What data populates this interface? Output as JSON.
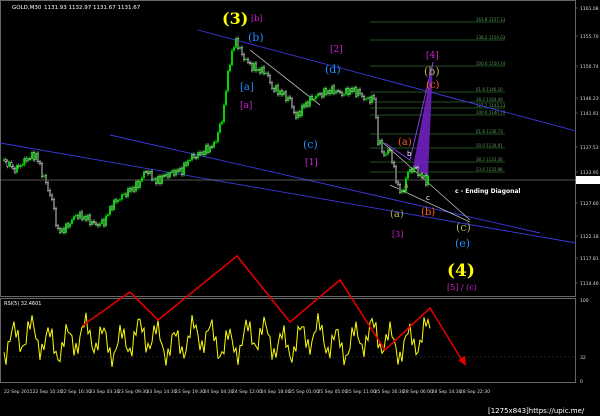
{
  "header": {
    "symbol": "GOLD,M30",
    "values": "1131.93 1132.97 1131.67 1131.67"
  },
  "colors": {
    "background": "#000000",
    "bull": "#00e000",
    "bear": "#ffffff",
    "channel": "#3a3ae0",
    "fib": "#2d6a2d",
    "yellow": "#ffff00",
    "cyan": "#1e90ff",
    "magenta": "#d020d0",
    "olive": "#b0b050",
    "orange": "#ff6020",
    "red": "#e00000",
    "purple": "#7020c0"
  },
  "labels": {
    "w3_big": "(3)",
    "w3_small": "[b]",
    "b_cyan": "(b)",
    "a_cyan": "[a]",
    "a_mag": "[a]",
    "b2_mag": "[2]",
    "d_cyan": "(d)",
    "c_cyan": "(c)",
    "one_mag": "[1]",
    "four_mag": "[4]",
    "b_olive": "(b)",
    "c_orange": "(c)",
    "a_orange": "(a)",
    "b_small": "b",
    "a_small": "a",
    "c_small": "c",
    "ending": "c - Ending Diagonal",
    "a_olive": "(a)",
    "b_orange": "(b)",
    "three_mag": "[3]",
    "c_olive": "(c)",
    "e_cyan": "(e)",
    "four_big": "(4)",
    "five_c": "[5] / (c)"
  },
  "fib_labels": [
    "161.8 1157.13",
    "138.2 1154.03",
    "100.0 1150.74",
    "61.8 1146.10",
    "38.2 1144.49",
    "127.2 1143.23",
    "100.0 1140.79",
    "61.8 1136.73",
    "50.0 1134.91",
    "38.2 1133.56",
    "23.6 1132.98"
  ],
  "price_axis": [
    "1161.08",
    "1155.70",
    "1150.74",
    "1146.23",
    "1141.91",
    "1137.53",
    "1133.95",
    "1131.67",
    "1127.60",
    "1122.18",
    "1117.81",
    "1114.46"
  ],
  "time_axis": [
    "22 Sep 2015",
    "22 Sep 10:30",
    "22 Sep 16:30",
    "23 Sep 03:30",
    "23 Sep 09:30",
    "23 Sep 14:30",
    "23 Sep 19:30",
    "24 Sep 04:30",
    "24 Sep 12:00",
    "24 Sep 18:00",
    "25 Sep 01:00",
    "25 Sep 05:00",
    "25 Sep 11:00",
    "25 Sep 16:30",
    "28 Sep 06:00",
    "28 Sep 14:30",
    "28 Sep 22:30"
  ],
  "rsi": {
    "label": "RSI(5) 32.4601",
    "axis": [
      "100",
      "32",
      "0"
    ]
  },
  "watermark": "[1275x843]https://upic.me/"
}
